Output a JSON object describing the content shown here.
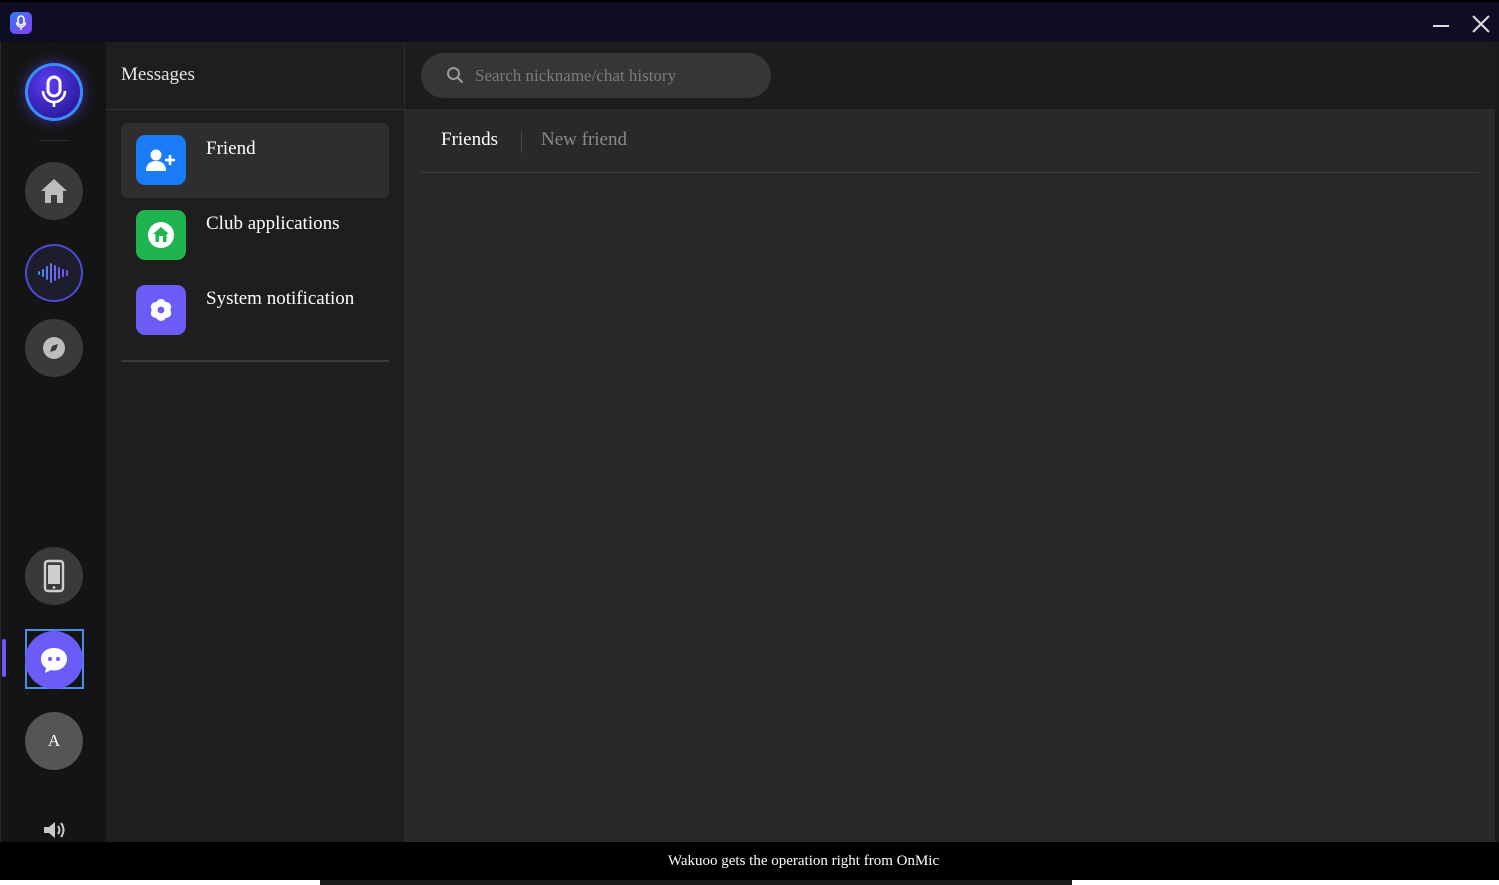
{
  "titlebar": {
    "logo_icon": "microphone-app-icon",
    "minimize_icon": "minimize-icon",
    "close_icon": "close-icon"
  },
  "rail": {
    "items": [
      {
        "name": "app-logo",
        "icon": "microphone-icon"
      },
      {
        "name": "home",
        "icon": "home-icon"
      },
      {
        "name": "voice",
        "icon": "sound-wave-icon"
      },
      {
        "name": "explore",
        "icon": "compass-icon"
      },
      {
        "name": "phone",
        "icon": "phone-icon"
      },
      {
        "name": "messages",
        "icon": "chat-icon",
        "active": true
      }
    ],
    "avatar_initial": "A",
    "sound_icon": "speaker-icon"
  },
  "messages": {
    "title": "Messages",
    "items": [
      {
        "label": "Friend",
        "icon": "add-friend-icon",
        "color": "#1a7af8",
        "active": true
      },
      {
        "label": "Club applications",
        "icon": "club-house-icon",
        "color": "#20b450"
      },
      {
        "label": "System notification",
        "icon": "gear-icon",
        "color": "#6b5cf7"
      }
    ]
  },
  "main": {
    "search": {
      "placeholder": "Search nickname/chat history",
      "value": ""
    },
    "tabs": [
      {
        "label": "Friends",
        "active": true
      },
      {
        "label": "New friend",
        "active": false
      }
    ]
  },
  "status": {
    "text": "Wakuoo gets the operation right from OnMic"
  },
  "colors": {
    "accent": "#6b5cf7",
    "titlebar_bg": "#0e0d24",
    "panel_bg": "#1e1e1e",
    "content_bg": "#292929"
  }
}
